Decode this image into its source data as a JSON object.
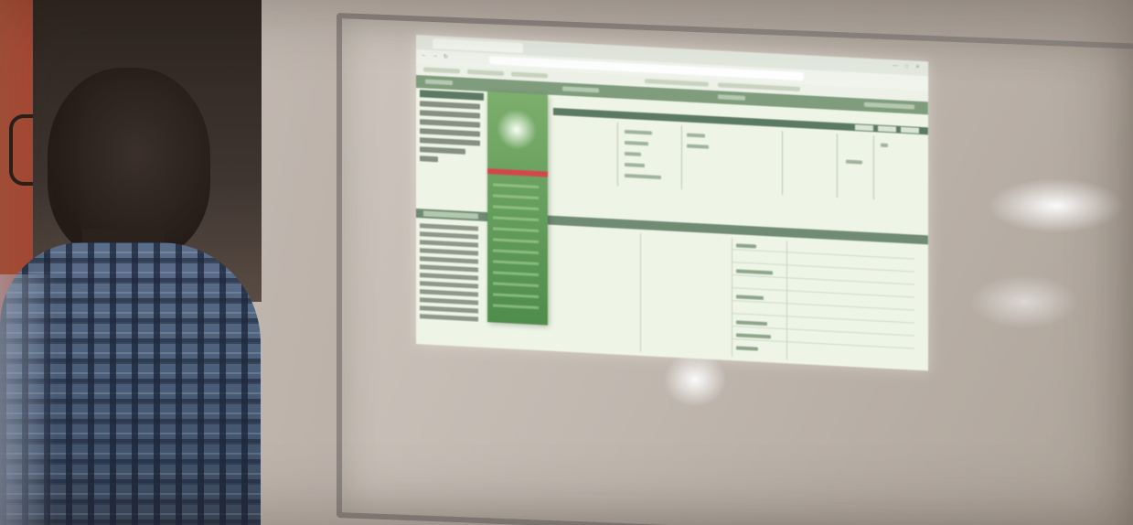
{
  "photo": {
    "subject": "",
    "scene_colors": {
      "wall": "#bdb3ab",
      "board_frame": "#8c8580",
      "projection_bg": "#eef5e6",
      "app_header_green": "#7f9c7c",
      "dropdown_green": "#4f8d4d",
      "dropdown_highlight": "#d3474a",
      "door": "#a3422f",
      "shirt_plaid": "#4a5d78"
    }
  },
  "projected_app": {
    "browser_tab_text": "",
    "url_text": "",
    "icons": [
      "back-icon",
      "forward-icon",
      "reload-icon",
      "close-icon"
    ]
  }
}
